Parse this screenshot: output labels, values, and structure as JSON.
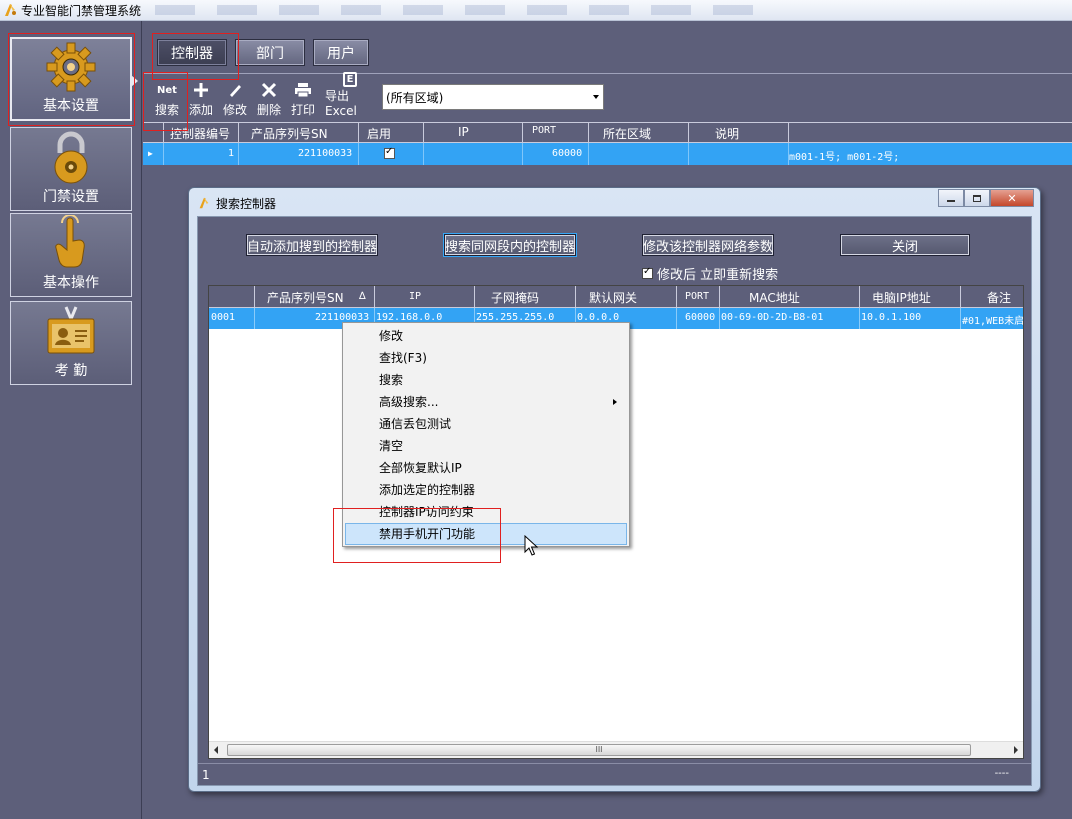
{
  "app": {
    "title": "专业智能门禁管理系统"
  },
  "sidebar": {
    "items": [
      {
        "label": "基本设置",
        "icon": "gear-icon",
        "active": true
      },
      {
        "label": "门禁设置",
        "icon": "lock-icon"
      },
      {
        "label": "基本操作",
        "icon": "hand-pointer-icon"
      },
      {
        "label": "考 勤",
        "icon": "id-card-icon"
      }
    ]
  },
  "tabs": [
    {
      "label": "控制器",
      "active": true
    },
    {
      "label": "部门"
    },
    {
      "label": "用户"
    }
  ],
  "toolbar": {
    "search": "搜索",
    "search_icon_text": "Net",
    "add": "添加",
    "edit": "修改",
    "delete": "删除",
    "print": "打印",
    "export": "导出Excel",
    "export_icon_text": "E",
    "area_select": "(所有区域)"
  },
  "main_grid": {
    "columns": [
      "控制器编号",
      "产品序列号SN",
      "启用",
      "IP",
      "PORT",
      "所在区域",
      "说明"
    ],
    "rows": [
      {
        "id": "1",
        "sn": "221100033",
        "enabled": true,
        "ip": "",
        "port": "60000",
        "area": "",
        "desc": "",
        "doors": "m001-1号;  m001-2号;"
      }
    ]
  },
  "dialog": {
    "title": "搜索控制器",
    "buttons": {
      "auto_add": "自动添加搜到的控制器",
      "search_segment": "搜索同网段内的控制器",
      "modify_net": "修改该控制器网络参数",
      "close": "关闭"
    },
    "checkbox": {
      "label": "修改后 立即重新搜索",
      "checked": true
    },
    "grid": {
      "columns": [
        "产品序列号SN",
        "IP",
        "子网掩码",
        "默认网关",
        "PORT",
        "MAC地址",
        "电脑IP地址",
        "备注"
      ],
      "sort_indicator": "∆",
      "rows": [
        {
          "idx": "0001",
          "sn": "221100033",
          "ip": "192.168.0.0",
          "mask": "255.255.255.0",
          "gateway": "0.0.0.0",
          "port": "60000",
          "mac": "00-69-0D-2D-B8-01",
          "pc_ip": "10.0.1.100",
          "note": "#01,WEB未启"
        }
      ]
    },
    "scroll_grip": "III",
    "status": {
      "left": "1",
      "right": "----"
    }
  },
  "context_menu": {
    "items": [
      {
        "label": "修改"
      },
      {
        "label": "查找(F3)"
      },
      {
        "label": "搜索"
      },
      {
        "label": "高级搜索...",
        "submenu": true
      },
      {
        "label": "通信丢包测试"
      },
      {
        "label": "清空"
      },
      {
        "label": "全部恢复默认IP"
      },
      {
        "label": "添加选定的控制器"
      },
      {
        "label": "控制器IP访问约束"
      },
      {
        "label": "禁用手机开门功能",
        "highlighted": true
      }
    ]
  },
  "colors": {
    "selection": "#33a3f4",
    "panel": "#5d5f7a",
    "annotation": "#e02020"
  }
}
